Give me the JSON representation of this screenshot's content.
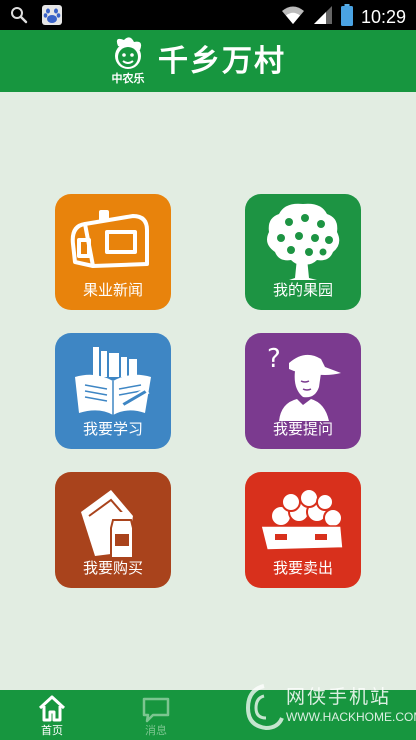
{
  "status_bar": {
    "time": "10:29",
    "icons": [
      "search-icon",
      "baidu-paw-icon",
      "wifi-icon",
      "signal-icon",
      "battery-icon"
    ]
  },
  "header": {
    "title": "千乡万村",
    "logo_sub": "中农乐"
  },
  "tiles": [
    {
      "label": "果业新闻",
      "color": "#e8830c",
      "icon": "news-mailbox-icon"
    },
    {
      "label": "我的果园",
      "color": "#1d9443",
      "icon": "fruit-tree-icon"
    },
    {
      "label": "我要学习",
      "color": "#3e86c4",
      "icon": "books-icon"
    },
    {
      "label": "我要提问",
      "color": "#7b3a8f",
      "icon": "question-farmer-icon"
    },
    {
      "label": "我要购买",
      "color": "#a9431c",
      "icon": "fertilizer-bottle-icon"
    },
    {
      "label": "我要卖出",
      "color": "#d8301c",
      "icon": "apple-crate-icon"
    }
  ],
  "tabs": [
    {
      "label": "首页",
      "icon": "home-icon",
      "active": true
    },
    {
      "label": "消息",
      "icon": "message-icon",
      "active": false
    }
  ],
  "watermark": {
    "text": "网侠手机站",
    "url": "WWW.HACKHOME.COM"
  },
  "colors": {
    "brand_green": "#17963f",
    "background": "#e2ede2"
  }
}
